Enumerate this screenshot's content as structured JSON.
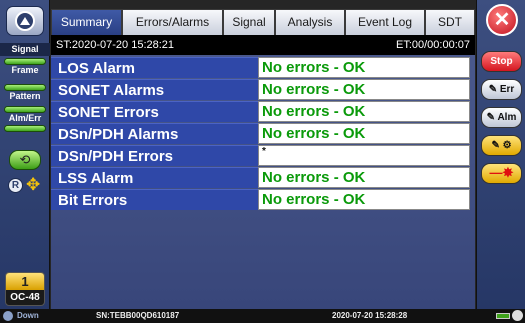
{
  "left_sidebar": {
    "top_label": "Signal",
    "items": [
      {
        "label": "Frame"
      },
      {
        "label": "Pattern"
      },
      {
        "label": "Alm/Err"
      }
    ],
    "port_badge": {
      "number": "1",
      "rate": "OC-48"
    }
  },
  "tabs": [
    {
      "label": "Summary",
      "active": true
    },
    {
      "label": "Errors/Alarms"
    },
    {
      "label": "Signal"
    },
    {
      "label": "Analysis"
    },
    {
      "label": "Event Log"
    },
    {
      "label": "SDT"
    }
  ],
  "header": {
    "start_time": "ST:2020-07-20 15:28:21",
    "elapsed_time": "ET:00/00:00:07"
  },
  "summary_rows": [
    {
      "name": "LOS Alarm",
      "status": "No errors - OK"
    },
    {
      "name": "SONET Alarms",
      "status": "No errors - OK"
    },
    {
      "name": "SONET Errors",
      "status": "No errors - OK"
    },
    {
      "name": "DSn/PDH Alarms",
      "status": "No errors - OK"
    },
    {
      "name": "DSn/PDH Errors",
      "status": "*"
    },
    {
      "name": "LSS Alarm",
      "status": "No errors - OK"
    },
    {
      "name": "Bit Errors",
      "status": "No errors - OK"
    }
  ],
  "right_sidebar": {
    "stop_label": "Stop",
    "err_label": "Err",
    "alm_label": "Alm"
  },
  "status_bar": {
    "power_state": "Down",
    "serial": "SN:TEBB00QD610187",
    "datetime": "2020-07-20 15:28:28"
  },
  "colors": {
    "ok_text": "#0a9a0a",
    "row_label_bg": "#2f48a8",
    "stop": "#d4151f"
  }
}
